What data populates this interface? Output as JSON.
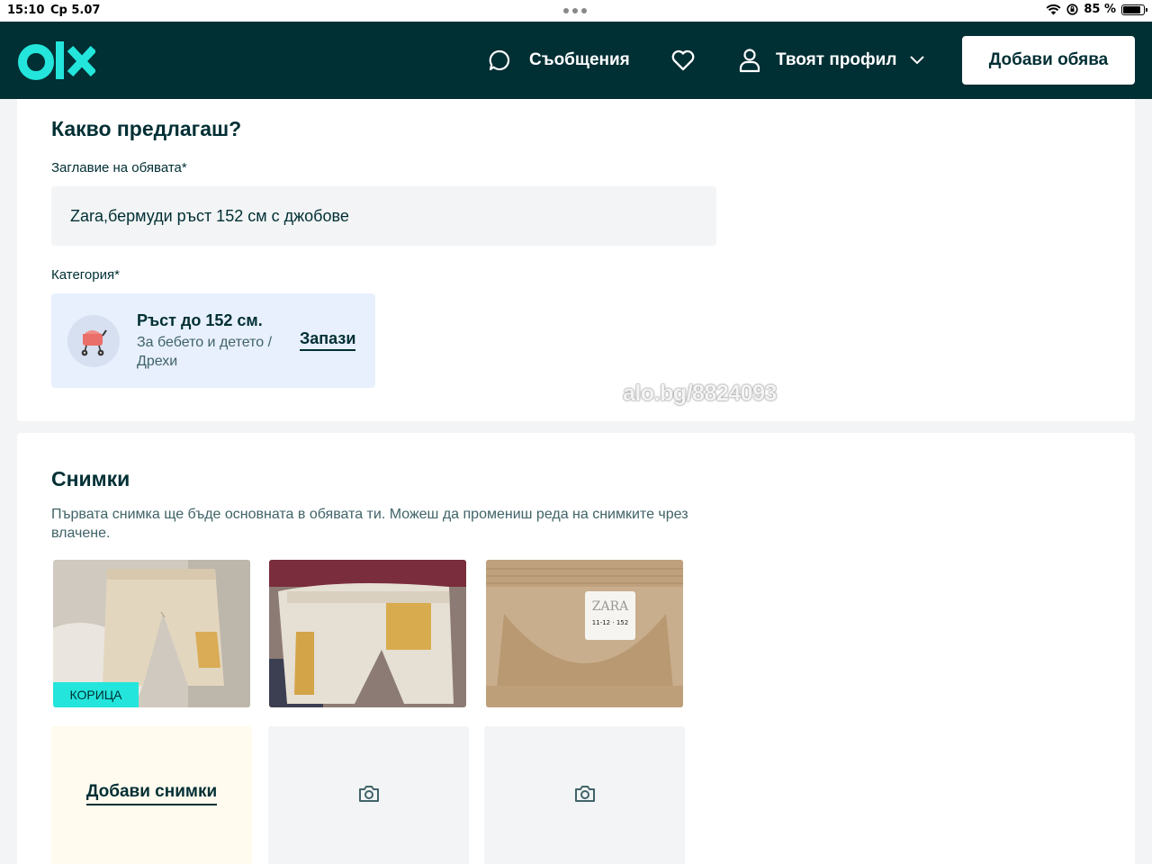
{
  "status_bar": {
    "time": "15:10",
    "date": "Ср 5.07",
    "battery": "85 %",
    "battery_level": 0.85
  },
  "header": {
    "logo": "olx-logo",
    "messages_label": "Съобщения",
    "profile_label": "Твоят профил",
    "add_listing_label": "Добави обява",
    "colors": {
      "background": "#002f34",
      "logo": "#23e5db",
      "text": "#ffffff"
    }
  },
  "listing": {
    "section_title": "Какво предлагаш?",
    "title_label": "Заглавие на обявата*",
    "title_value": "Zara,бермуди ръст 152 см с джобове",
    "category_label": "Категория*",
    "category": {
      "icon": "stroller-icon",
      "name": "Ръст до 152 см.",
      "path": "За бебето и детето / Дрехи",
      "save_label": "Запази"
    },
    "watermark": "alo.bg/8824093"
  },
  "photos": {
    "section_title": "Снимки",
    "hint": "Първата снимка ще бъде основната в обявата ти. Можеш да промениш реда на снимките чрез влачене.",
    "cover_badge": "КОРИЦА",
    "add_photos_label": "Добави снимки",
    "items": [
      {
        "icon": "shorts-photo-front"
      },
      {
        "icon": "shorts-photo-back"
      },
      {
        "icon": "shorts-photo-label"
      }
    ],
    "empty_slot_icon": "camera-icon",
    "colors": {
      "cover_badge": "#23e5db",
      "add_slot_bg": "#fffbef"
    }
  }
}
